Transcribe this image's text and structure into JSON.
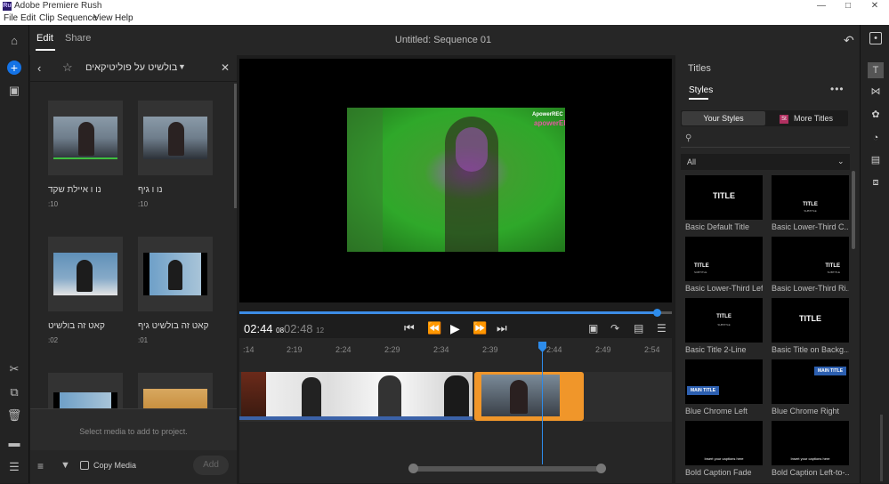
{
  "window": {
    "title": "Adobe Premiere Rush",
    "logo": "Ru"
  },
  "menu": [
    "File",
    "Edit",
    "Clip",
    "Sequence",
    "View",
    "Help"
  ],
  "topbar": {
    "edit_tab": "Edit",
    "share_tab": "Share",
    "sequence_title": "Untitled: Sequence 01"
  },
  "media": {
    "folder_title": "בולשיט על פוליטיקאים",
    "items": [
      {
        "label": "נו ו איילת שקד",
        "duration": ":10"
      },
      {
        "label": "נו ו גיף",
        "duration": ":10"
      },
      {
        "label": "קאט זה בולשיט",
        "duration": ":02"
      },
      {
        "label": "קאט זה בולשיט גיף",
        "duration": ":01"
      }
    ],
    "empty_hint": "Select media to add to project.",
    "copy_media_label": "Copy Media",
    "add_label": "Add"
  },
  "preview": {
    "watermark_top": "ApowerREC",
    "watermark_bottom": "apowerED"
  },
  "transport": {
    "current_time": "02:44",
    "current_frames": "08",
    "duration_time": "02:48",
    "duration_frames": "12"
  },
  "timeline": {
    "ticks": [
      ":14",
      "2:19",
      "2:24",
      "2:29",
      "2:34",
      "2:39",
      "2:44",
      "2:49",
      "2:54"
    ]
  },
  "titles_panel": {
    "heading": "Titles",
    "styles_tab": "Styles",
    "your_styles_label": "Your Styles",
    "more_titles_label": "More Titles",
    "more_titles_badge": "St",
    "filter_value": "All",
    "cards": [
      {
        "label": "Basic Default Title",
        "preview_text": "TITLE",
        "sub": ""
      },
      {
        "label": "Basic Lower-Third C...",
        "preview_text": "TITLE",
        "sub": "SUBTITLE"
      },
      {
        "label": "Basic Lower-Third Left",
        "preview_text": "TITLE",
        "sub": "SUBTITLE"
      },
      {
        "label": "Basic Lower-Third Ri...",
        "preview_text": "TITLE",
        "sub": "SUBTITLE"
      },
      {
        "label": "Basic Title 2-Line",
        "preview_text": "TITLE",
        "sub": "SUBTITLE"
      },
      {
        "label": "Basic Title on Backg...",
        "preview_text": "TITLE",
        "sub": ""
      },
      {
        "label": "Blue Chrome Left",
        "preview_text": "MAIN TITLE",
        "sub": ""
      },
      {
        "label": "Blue Chrome Right",
        "preview_text": "MAIN TITLE",
        "sub": ""
      },
      {
        "label": "Bold Caption Fade",
        "preview_text": "Insert your captions here",
        "sub": ""
      },
      {
        "label": "Bold Caption Left-to-...",
        "preview_text": "Insert your captions here",
        "sub": ""
      }
    ]
  },
  "colors": {
    "accent_blue": "#1473e6",
    "playhead": "#2d8ceb",
    "selected_clip": "#f0962a"
  }
}
